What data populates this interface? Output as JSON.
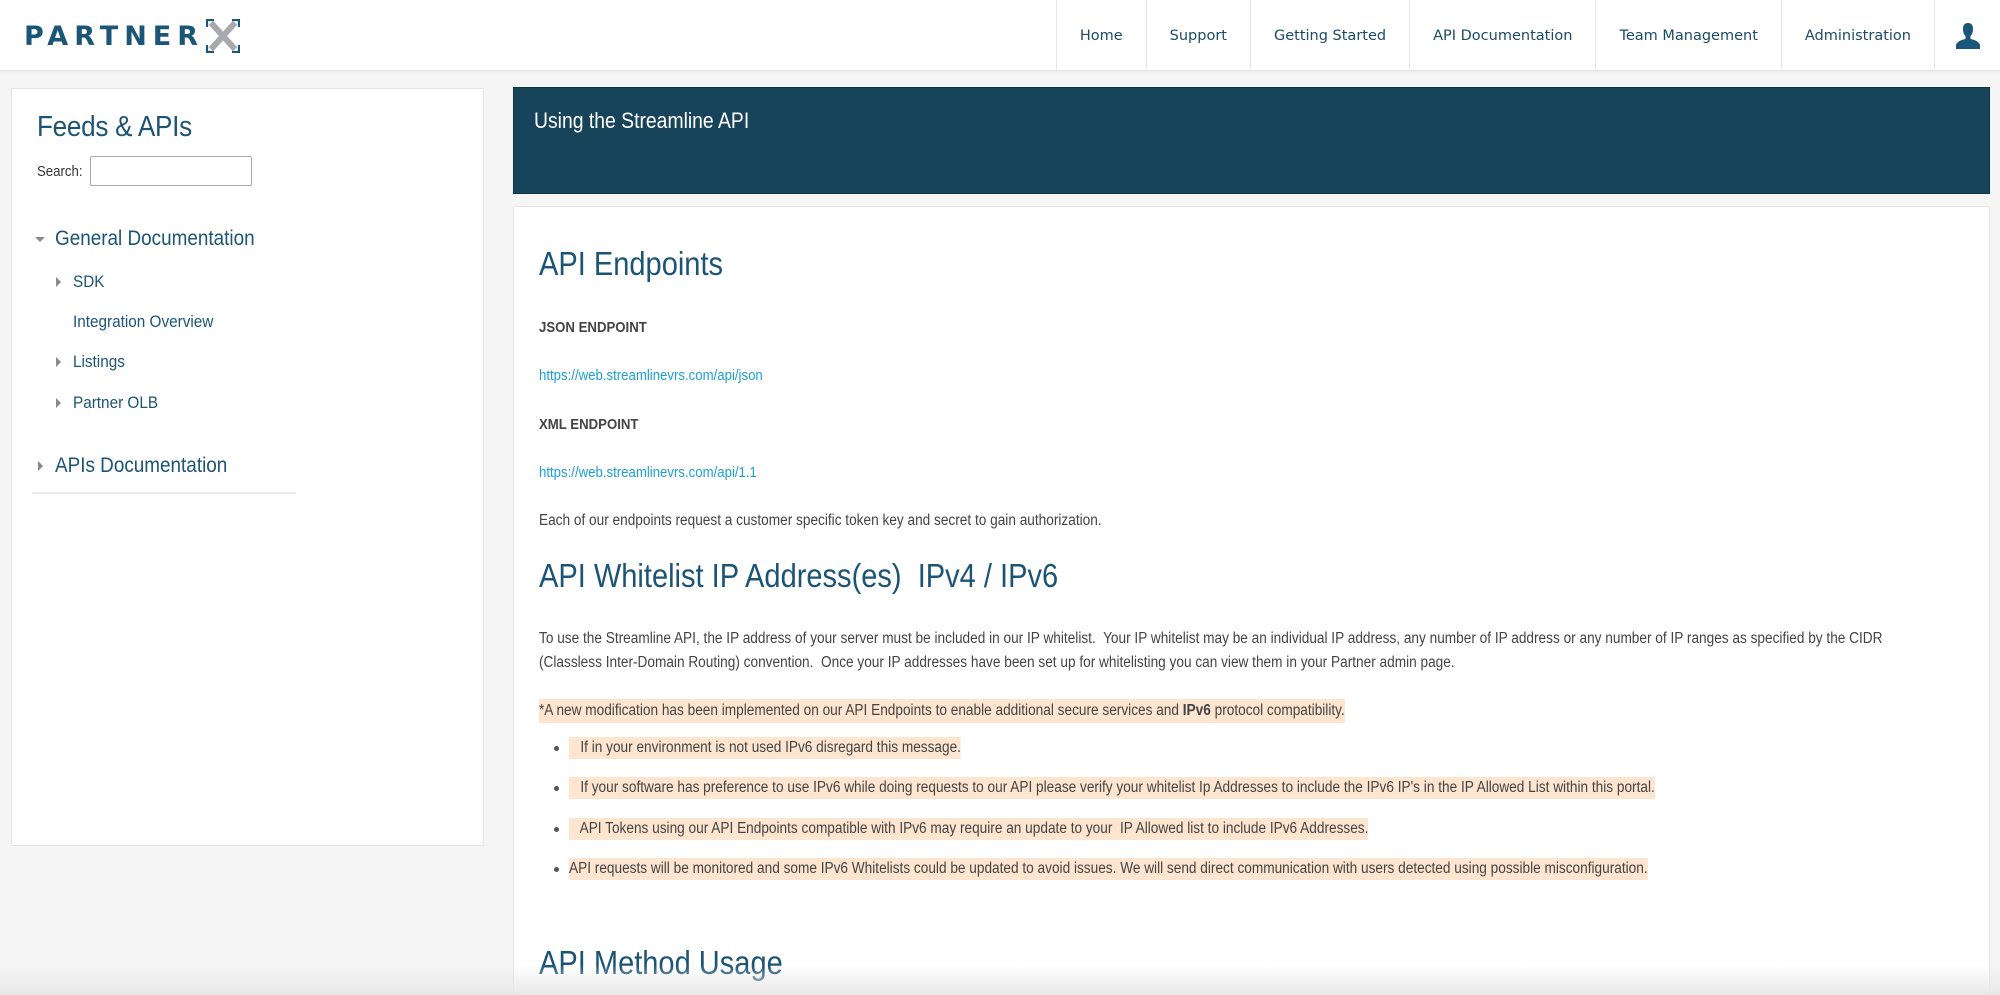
{
  "header": {
    "logo_text": "PARTNER",
    "logo_mark": "X",
    "nav": [
      {
        "label": "Home"
      },
      {
        "label": "Support"
      },
      {
        "label": "Getting Started"
      },
      {
        "label": "API Documentation"
      },
      {
        "label": "Team Management"
      },
      {
        "label": "Administration"
      }
    ],
    "user_icon": "user-icon"
  },
  "sidebar": {
    "title": "Feeds & APIs",
    "search_label": "Search:",
    "search_value": "",
    "tree": [
      {
        "label": "General Documentation",
        "level": 0,
        "state": "expanded"
      },
      {
        "label": "SDK",
        "level": 1,
        "state": "collapsed"
      },
      {
        "label": "Integration Overview",
        "level": 1,
        "state": "leaf"
      },
      {
        "label": "Listings",
        "level": 1,
        "state": "collapsed"
      },
      {
        "label": "Partner OLB",
        "level": 1,
        "state": "collapsed"
      },
      {
        "label": "APIs Documentation",
        "level": 0,
        "state": "collapsed"
      }
    ]
  },
  "main": {
    "banner_title": "Using the Streamline API",
    "sections": {
      "endpoints": {
        "heading": "API Endpoints",
        "json_label": "JSON ENDPOINT",
        "json_url": "https://web.streamlinevrs.com/api/json",
        "xml_label": "XML ENDPOINT",
        "xml_url": "https://web.streamlinevrs.com/api/1.1",
        "note": "Each of our endpoints request a customer specific token key and secret to gain authorization."
      },
      "whitelist": {
        "heading": "API Whitelist IP Address(es)  IPv4 / IPv6",
        "para_line1": "To use the Streamline API, the IP address of your server must be included in our IP whitelist.  Your IP whitelist may be an individual IP address, any number of IP address or any number of IP ranges as specified by the CIDR",
        "para_line2": "(Classless Inter-Domain Routing) convention.  Once your IP addresses have been set up for whitelisting you can view them in your Partner admin page.",
        "notice_prefix": "*A new modification has been implemented on our API Endpoints to enable additional secure services and ",
        "notice_bold": "IPv6",
        "notice_suffix": " protocol compatibility.",
        "bullets": [
          "   If in your environment is not used IPv6 disregard this message.",
          "   If your software has preference to use IPv6 while doing requests to our API please verify your whitelist Ip Addresses to include the IPv6 IP's in the IP Allowed List within this portal.",
          "   API Tokens using our API Endpoints compatible with IPv6 may require an update to your  IP Allowed list to include IPv6 Addresses.",
          "API requests will be monitored and some IPv6 Whitelists could be updated to avoid issues. We will send direct communication with users detected using possible misconfiguration."
        ]
      },
      "method_usage": {
        "heading": "API Method Usage"
      }
    }
  },
  "colors": {
    "brand": "#1b5678",
    "banner_bg": "#18445b",
    "link": "#1a9fd9",
    "highlight": "#fde5cf",
    "page_bg": "#f5f5f5"
  }
}
